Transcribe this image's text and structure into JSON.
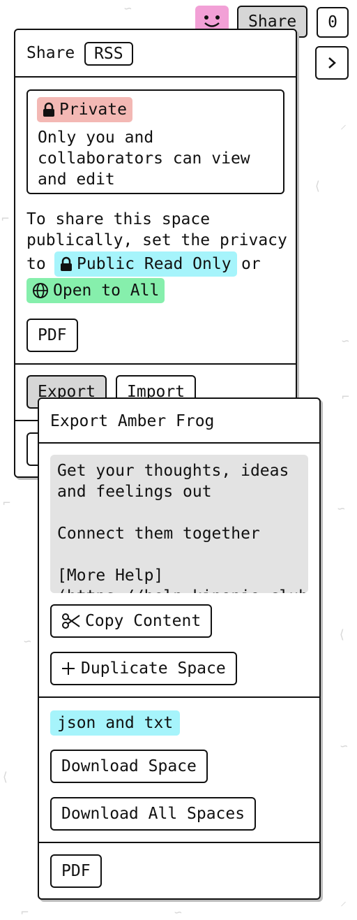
{
  "header": {
    "share_label": "Share",
    "user_count": "0"
  },
  "share_panel": {
    "title": "Share",
    "rss_label": "RSS",
    "privacy_badge": "Private",
    "privacy_description": "Only you and collaborators can view and edit",
    "public_text_line1": "To share this space",
    "public_text_line2": "publically, set the privacy",
    "public_text_to": "to",
    "public_read_only_label": "Public Read Only",
    "or_text": "or",
    "open_to_all_label": "Open to All",
    "pdf_label": "PDF",
    "export_label": "Export",
    "import_label": "Import"
  },
  "export_panel": {
    "title": "Export Amber Frog",
    "content": "Get your thoughts, ideas\nand feelings out\n\nConnect them together\n\n[More Help]\n(https://help.kinopio.club",
    "copy_content_label": "Copy Content",
    "duplicate_space_label": "Duplicate Space",
    "format_badge": "json and txt",
    "download_space_label": "Download Space",
    "download_all_label": "Download All Spaces",
    "pdf_label": "PDF"
  },
  "colors": {
    "private_badge": "#f3b8b4",
    "public_read_only_badge": "#a6f4fb",
    "open_to_all_badge": "#86efac",
    "json_badge": "#a6f4fb",
    "avatar": "#f2a0d6",
    "textarea_bg": "#e3e3e3"
  }
}
